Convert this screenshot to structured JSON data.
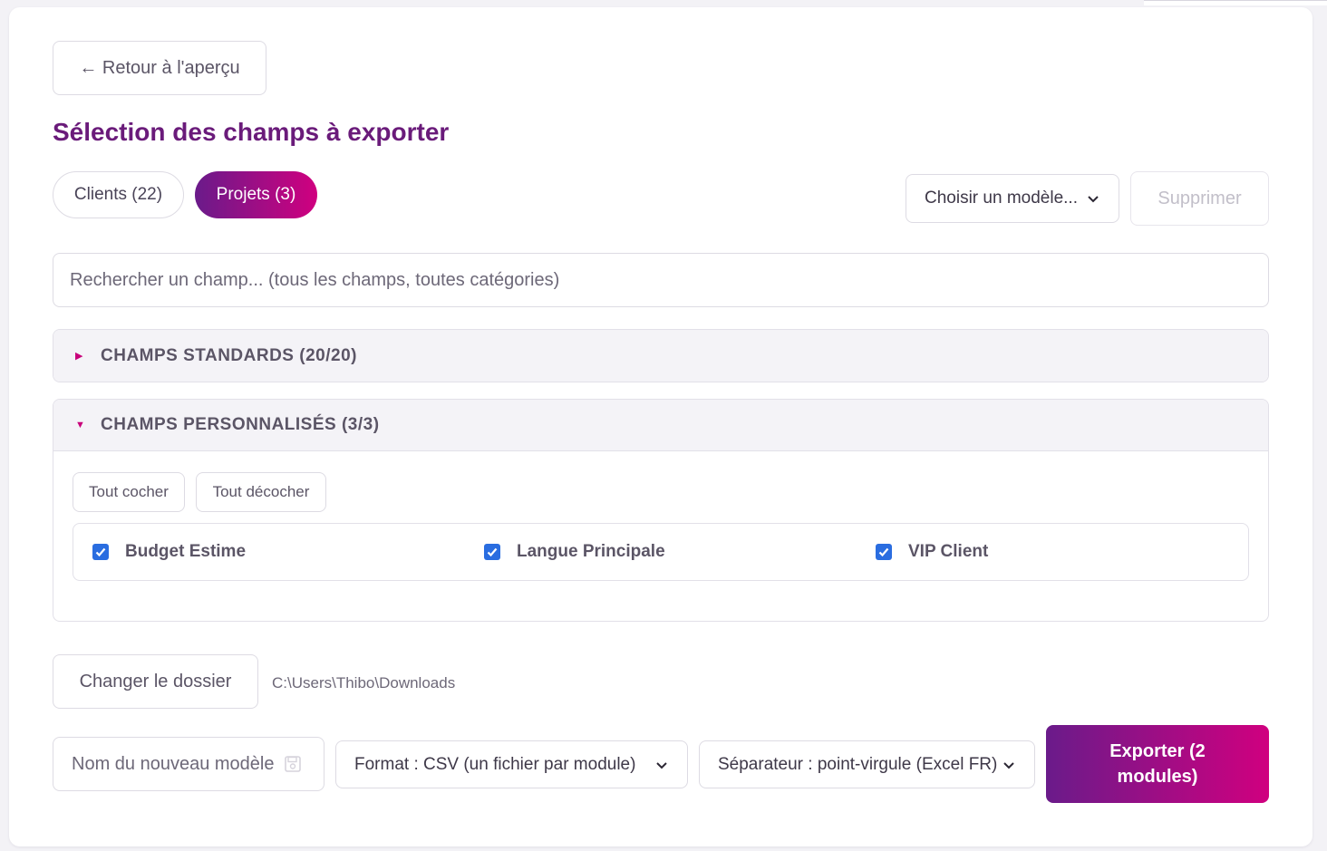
{
  "header": {
    "back_label": "← Retour à l'aperçu",
    "title": "Sélection des champs à exporter"
  },
  "tabs": [
    {
      "label": "Clients (22)",
      "active": false
    },
    {
      "label": "Projets (3)",
      "active": true
    }
  ],
  "templates": {
    "select_value": "Choisir un modèle...",
    "delete_label": "Supprimer"
  },
  "search": {
    "placeholder": "Rechercher un champ... (tous les champs, toutes catégories)"
  },
  "sections": {
    "standard": {
      "title": "CHAMPS STANDARDS (20/20)",
      "expanded": false
    },
    "custom": {
      "title": "CHAMPS PERSONNALISÉS (3/3)",
      "expanded": true,
      "check_all_label": "Tout cocher",
      "uncheck_all_label": "Tout décocher",
      "fields": [
        {
          "label": "Budget Estime",
          "checked": true
        },
        {
          "label": "Langue Principale",
          "checked": true
        },
        {
          "label": "VIP Client",
          "checked": true
        }
      ]
    }
  },
  "folder": {
    "change_label": "Changer le dossier",
    "path": "C:\\Users\\Thibo\\Downloads"
  },
  "footer": {
    "model_name_placeholder": "Nom du nouveau modèle",
    "format_value": "Format : CSV (un fichier par module)",
    "separator_value": "Séparateur : point-virgule (Excel FR)",
    "export_label": "Exporter (2 modules)"
  },
  "colors": {
    "accent_start": "#6a1b8a",
    "accent_end": "#d0007f",
    "title": "#6a1b7a",
    "checkbox": "#2a6de0"
  }
}
